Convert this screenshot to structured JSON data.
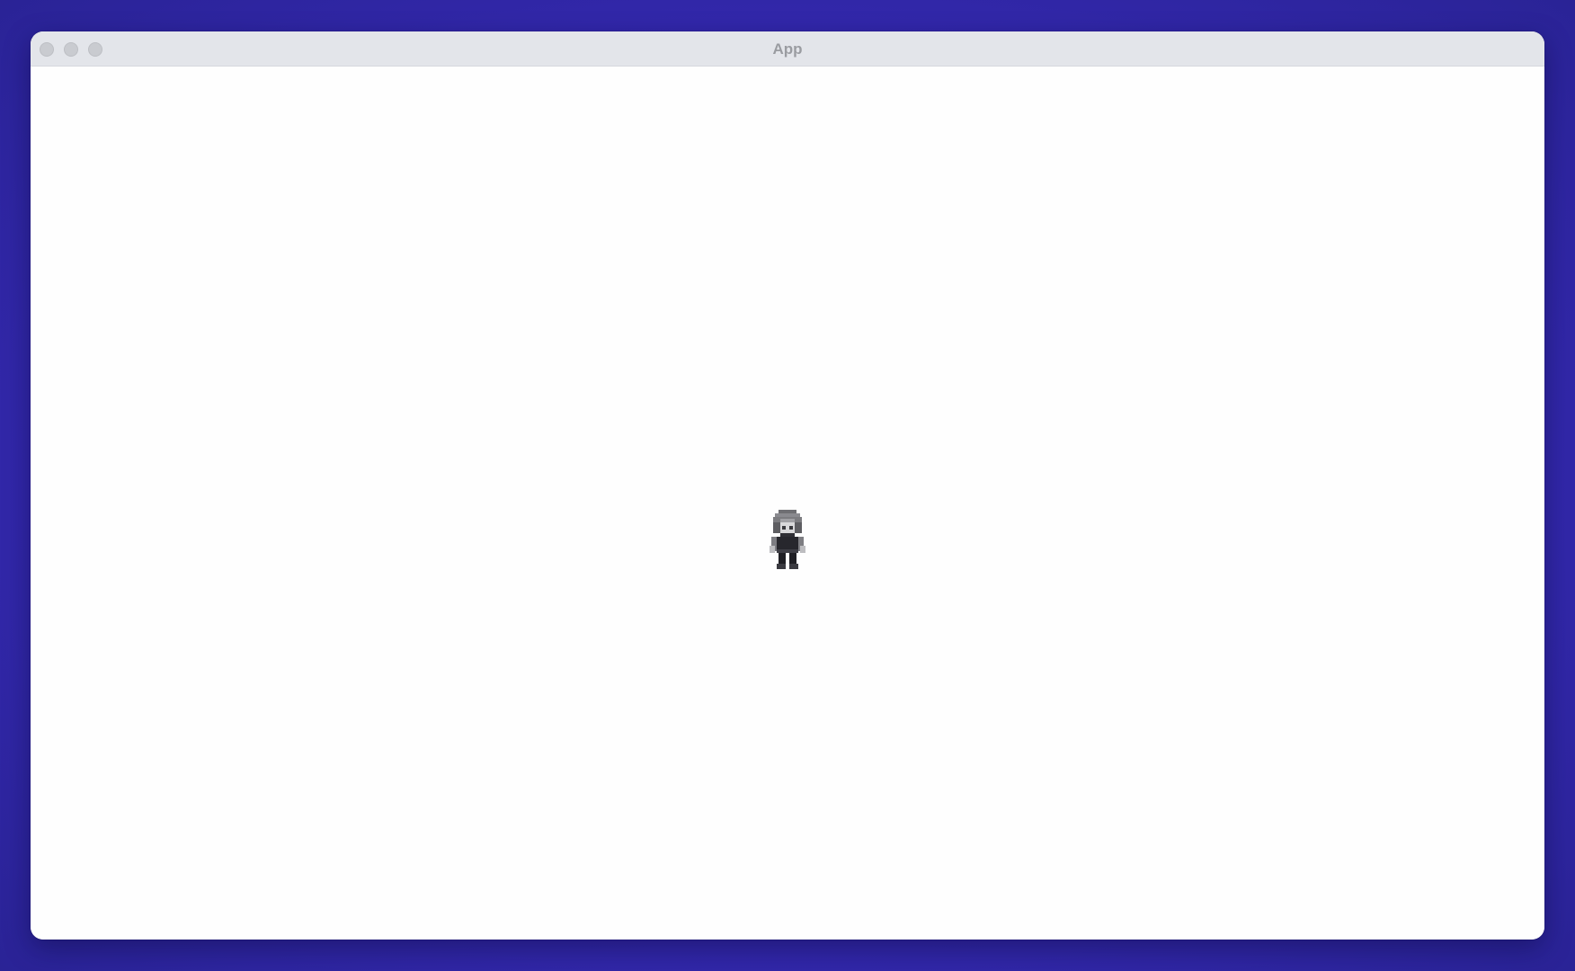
{
  "window": {
    "title": "App"
  },
  "titlebar": {
    "buttons": [
      "close-button",
      "minimize-button",
      "zoom-button"
    ]
  },
  "scene": {
    "sprite": "pixel-character-sprite"
  }
}
